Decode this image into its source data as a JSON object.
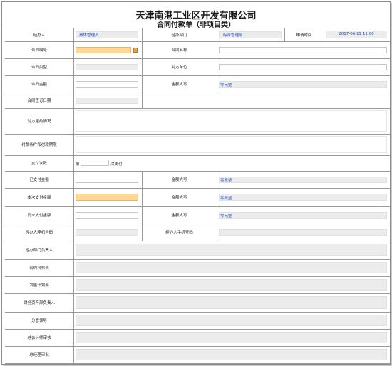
{
  "title": "天津南港工业区开发有限公司",
  "subtitle": "合同付款单（非项目类）",
  "fields": {
    "handler_label": "经办人",
    "handler_value": "黑体管理员",
    "handler_dept_label": "经办部门",
    "handler_dept_value": "综合管理部",
    "apply_time_label": "申请时间",
    "apply_time_value": "2017-06-19 11:00",
    "contract_no_label": "合同编号",
    "contract_name_label": "合同名称",
    "contract_type_label": "合同类型",
    "counterparty_label": "对方单位",
    "contract_amount_label": "合同金额",
    "amount_upper_label": "金额大写",
    "amount_upper_value": "零元整",
    "sign_date_label": "合同签订日期",
    "performance_label": "对方履约情况",
    "pay_terms_label": "付款条件和付款期限",
    "pay_times_label": "支付次数",
    "pay_times_prefix": "第",
    "pay_times_suffix": "次支付",
    "paid_amount_label": "已支付金额",
    "paid_upper_label": "金额大写",
    "paid_upper_value": "零元整",
    "this_amount_label": "本次支付金额",
    "this_upper_label": "金额大写",
    "this_upper_value": "零元整",
    "unpaid_amount_label": "尚未支付金额",
    "unpaid_upper_label": "金额大写",
    "unpaid_upper_value": "零元整",
    "handler_phone_label": "经办人座机号码",
    "handler_mobile_label": "经办人手机号码",
    "dept_head_label": "经办部门负责人",
    "contract_section_label": "合约科科长",
    "dev_dept_label": "发展计划部",
    "finance_head_label": "财务资产部负责人",
    "leader_label": "分管领导",
    "chief_accountant_label": "总会计师审核",
    "gm_label": "总经理审批"
  }
}
